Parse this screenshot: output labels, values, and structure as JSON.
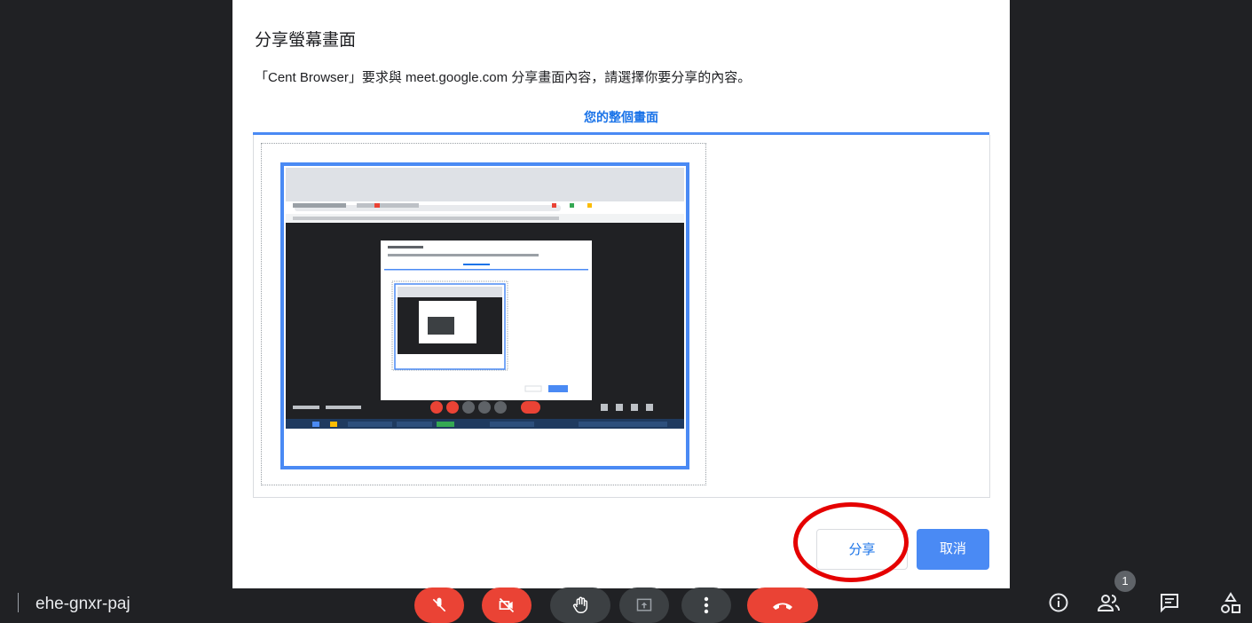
{
  "dialog": {
    "title": "分享螢幕畫面",
    "description": "「Cent Browser」要求與 meet.google.com 分享畫面內容，請選擇你要分享的內容。",
    "tab_label": "您的整個畫面",
    "source_item_name": "entire-screen",
    "share_label": "分享",
    "cancel_label": "取消"
  },
  "meeting": {
    "code": "ehe-gnxr-paj",
    "participant_count": "1"
  },
  "controls": {
    "mic": "mic-off-icon",
    "camera": "camera-off-icon",
    "raise_hand": "hand-icon",
    "present": "present-icon",
    "more": "more-vert-icon",
    "leave": "call-end-icon"
  },
  "colors": {
    "accent": "#1a73e8",
    "danger": "#ea4335",
    "background": "#202124"
  }
}
